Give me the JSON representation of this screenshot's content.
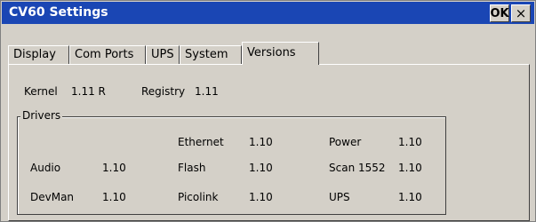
{
  "window": {
    "title": "CV60 Settings",
    "ok_label": "OK",
    "close_label": "×"
  },
  "tabs": [
    {
      "label": "Display",
      "active": false
    },
    {
      "label": "Com Ports",
      "active": false
    },
    {
      "label": "UPS",
      "active": false
    },
    {
      "label": "System",
      "active": false
    },
    {
      "label": "Versions",
      "active": true
    }
  ],
  "versions": {
    "kernel_label": "Kernel",
    "kernel_value": "1.11 R",
    "registry_label": "Registry",
    "registry_value": "1.11",
    "drivers_title": "Drivers",
    "drivers": [
      {
        "name": "Audio",
        "version": "1.10"
      },
      {
        "name": "DevMan",
        "version": "1.10"
      },
      {
        "name": "Ethernet",
        "version": "1.10"
      },
      {
        "name": "Flash",
        "version": "1.10"
      },
      {
        "name": "Picolink",
        "version": "1.10"
      },
      {
        "name": "Power",
        "version": "1.10"
      },
      {
        "name": "Scan 1552",
        "version": "1.10"
      },
      {
        "name": "UPS",
        "version": "1.10"
      }
    ]
  }
}
